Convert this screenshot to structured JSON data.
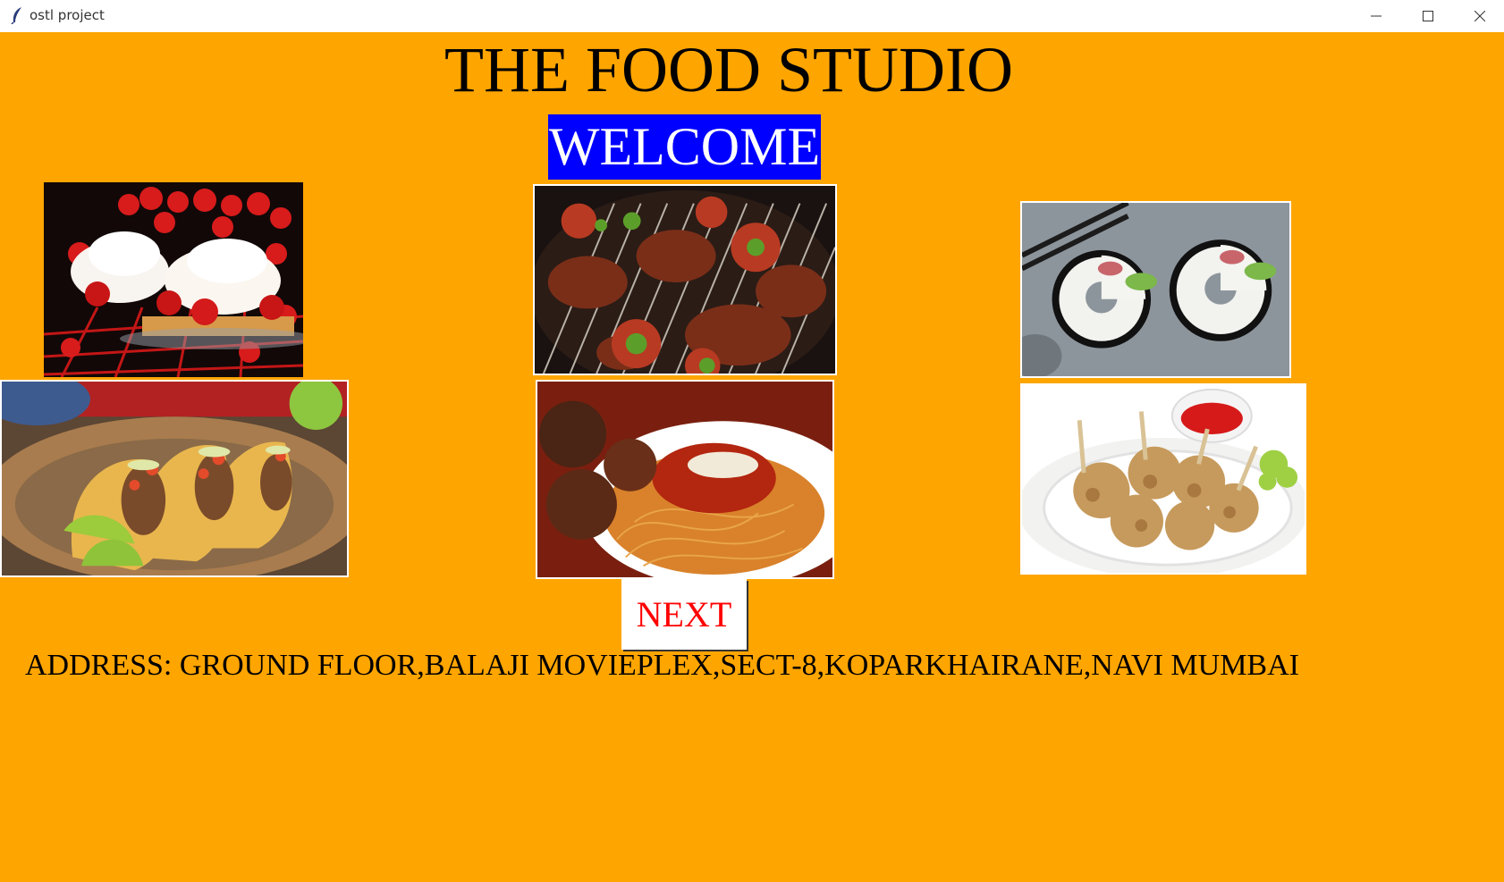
{
  "window": {
    "title": "ostl project",
    "app_icon": "feather-icon",
    "controls": [
      "minimize-icon",
      "maximize-icon",
      "close-icon"
    ]
  },
  "header": {
    "title": "THE FOOD STUDIO",
    "welcome": "WELCOME"
  },
  "images": [
    {
      "name": "strawberry-dessert-image"
    },
    {
      "name": "grilled-meat-image"
    },
    {
      "name": "sushi-donut-image"
    },
    {
      "name": "tacos-image"
    },
    {
      "name": "spaghetti-meatballs-image"
    },
    {
      "name": "fried-lollipop-image"
    }
  ],
  "actions": {
    "next_label": "NEXT"
  },
  "footer": {
    "address": "ADDRESS: GROUND FLOOR,BALAJI MOVIEPLEX,SECT-8,KOPARKHAIRANE,NAVI MUMBAI"
  },
  "colors": {
    "background": "#ffa500",
    "welcome_bg": "#0000ff",
    "welcome_text": "#ffffff",
    "next_text": "#ff0000"
  }
}
